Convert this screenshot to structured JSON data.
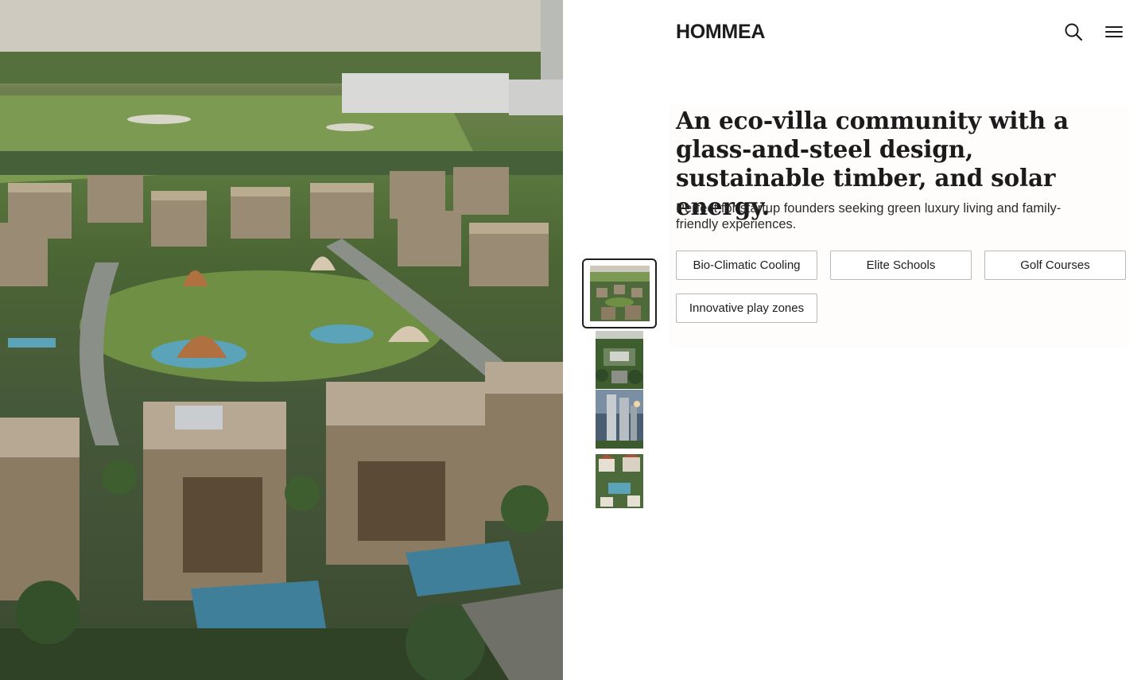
{
  "header": {
    "logo": "HOMMEA",
    "search_icon": "search-icon",
    "menu_icon": "hamburger-menu-icon"
  },
  "hero": {
    "image": "aerial-view-eco-villa-community"
  },
  "thumbnails": [
    {
      "image": "aerial-villas-thumbnail",
      "active": true
    },
    {
      "image": "green-campus-thumbnail",
      "active": false
    },
    {
      "image": "glass-towers-thumbnail",
      "active": false
    },
    {
      "image": "villa-courtyard-thumbnail",
      "active": false
    }
  ],
  "content": {
    "headline": "An eco-villa community with a glass-and-steel design, sustainable timber, and solar energy.",
    "description": "Perfect for startup founders seeking green luxury living and family-friendly experiences.",
    "features": [
      "Bio-Climatic Cooling",
      "Elite Schools",
      "Golf Courses",
      "Innovative play zones"
    ]
  },
  "colors": {
    "text": "#1c1c1c",
    "chip_border": "#b9b9b9",
    "active_thumb_border": "#1f1f1f"
  }
}
